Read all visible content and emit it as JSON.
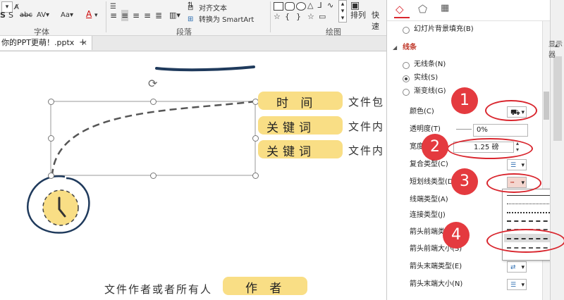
{
  "ribbon": {
    "groups": {
      "font": "字体",
      "paragraph": "段落",
      "drawing": "绘图"
    },
    "align_text": "对齐文本",
    "convert_smartart": "转换为 SmartArt",
    "arrange": "排列",
    "quick_styles": "快速"
  },
  "tabs": {
    "doc_tab": "你的PPT更萌！.pptx",
    "add_tab": "+",
    "right_label": "显示器"
  },
  "slide": {
    "highlights": [
      "时 间",
      "关键词",
      "关键词",
      "作 者"
    ],
    "side_texts": [
      "文件包",
      "文件内",
      "文件内"
    ],
    "author_text": "文件作者或者所有人"
  },
  "pane": {
    "slide_bg_fill": "幻灯片背景填充(B)",
    "line_section": "线条",
    "no_line": "无线条(N)",
    "solid_line": "实线(S)",
    "gradient_line": "渐变线(G)",
    "color": "颜色(C)",
    "transparency": "透明度(T)",
    "transparency_value": "0%",
    "width": "宽度(W)",
    "width_value": "1.25 磅",
    "compound_type": "复合类型(C)",
    "dash_type": "短划线类型(D)",
    "cap_type": "线端类型(A)",
    "join_type": "连接类型(J)",
    "arrow_begin_type": "箭头前端类型(B)",
    "arrow_begin_size": "箭头前端大小(S)",
    "arrow_end_type": "箭头末端类型(E)",
    "arrow_end_size": "箭头末端大小(N)"
  },
  "badges": [
    "1",
    "2",
    "3",
    "4"
  ],
  "colors": {
    "badge": "#e43a3f",
    "highlight": "#f9de85",
    "accent_red": "#d9262e",
    "navy": "#1f3a5c"
  }
}
